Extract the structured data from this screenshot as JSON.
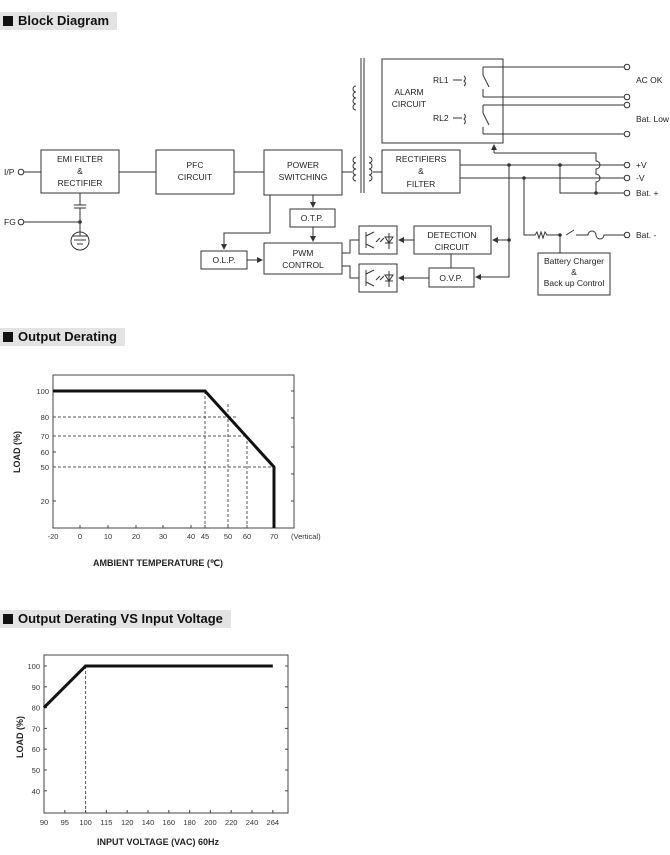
{
  "sections": {
    "block_diagram": "Block Diagram",
    "output_derating": "Output Derating",
    "derating_vs_input": "Output Derating VS Input Voltage"
  },
  "block_diagram": {
    "emi_1": "EMI FILTER",
    "emi_2": "&",
    "emi_3": "RECTIFIER",
    "pfc_1": "PFC",
    "pfc_2": "CIRCUIT",
    "ps_1": "POWER",
    "ps_2": "SWITCHING",
    "rect_1": "RECTIFIERS",
    "rect_2": "&",
    "rect_3": "FILTER",
    "alarm_1": "ALARM",
    "alarm_2": "CIRCUIT",
    "rl1": "RL1",
    "rl2": "RL2",
    "otp": "O.T.P.",
    "olp": "O.L.P.",
    "pwm_1": "PWM",
    "pwm_2": "CONTROL",
    "det_1": "DETECTION",
    "det_2": "CIRCUIT",
    "ovp": "O.V.P.",
    "bat_1": "Battery Charger",
    "bat_2": "&",
    "bat_3": "Back up Control",
    "ip": "I/P",
    "fg": "FG",
    "ac_ok": "AC OK",
    "bat_low": "Bat. Low",
    "plus_v": "+V",
    "minus_v": "-V",
    "bat_plus": "Bat. +",
    "bat_minus": "Bat. -"
  },
  "chart_data": [
    {
      "type": "line",
      "title": "",
      "xlabel": "AMBIENT TEMPERATURE (℃)",
      "ylabel": "LOAD (%)",
      "x_note": "(Vertical)",
      "x_ticks": [
        "-20",
        "0",
        "10",
        "20",
        "30",
        "40",
        "45",
        "50",
        "60",
        "70"
      ],
      "y_ticks": [
        "100",
        "80",
        "70",
        "60",
        "50",
        "20"
      ],
      "series": [
        {
          "points": [
            [
              -20,
              100
            ],
            [
              45,
              100
            ],
            [
              70,
              50
            ],
            [
              70,
              0
            ]
          ]
        }
      ],
      "reference_lines": {
        "x": [
          45,
          50,
          60
        ],
        "y": [
          80,
          70,
          50
        ]
      },
      "grid": false
    },
    {
      "type": "line",
      "title": "",
      "xlabel": "INPUT VOLTAGE (VAC) 60Hz",
      "ylabel": "LOAD (%)",
      "x_ticks": [
        "90",
        "95",
        "100",
        "115",
        "120",
        "140",
        "160",
        "180",
        "200",
        "220",
        "240",
        "264"
      ],
      "y_ticks": [
        "100",
        "90",
        "80",
        "70",
        "60",
        "50",
        "40"
      ],
      "series": [
        {
          "points": [
            [
              90,
              80
            ],
            [
              100,
              100
            ],
            [
              264,
              100
            ]
          ]
        }
      ],
      "reference_lines": {
        "x": [
          100
        ]
      },
      "grid": false
    }
  ]
}
